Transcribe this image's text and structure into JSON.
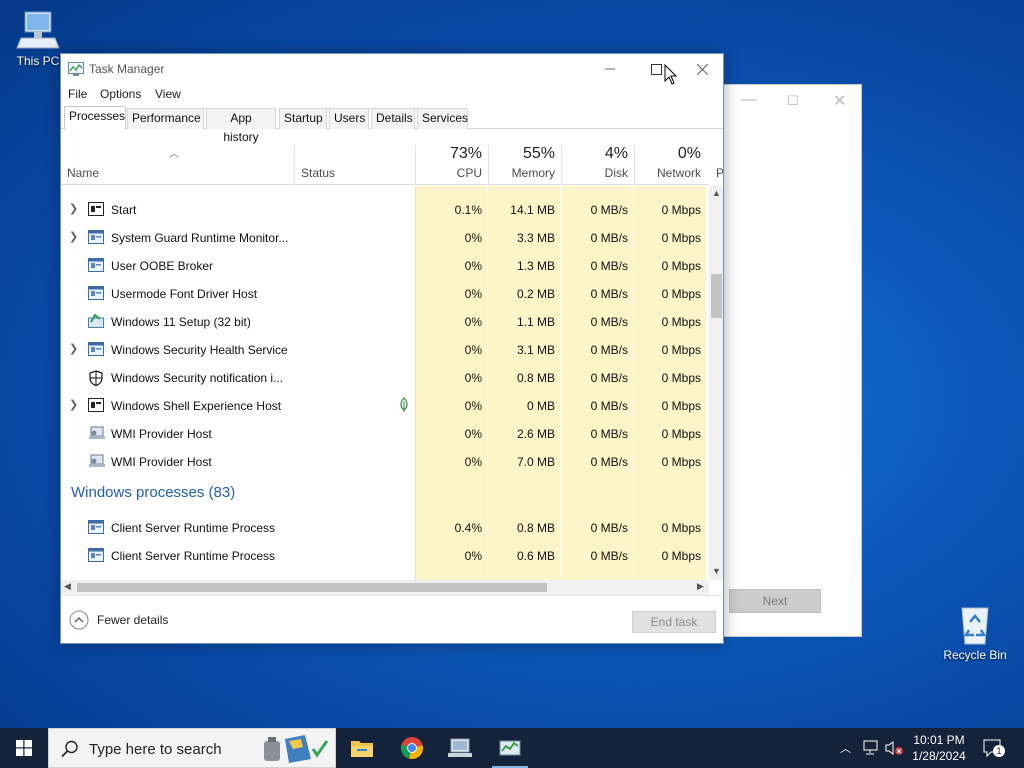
{
  "desktop": {
    "icons": [
      {
        "label": "This PC",
        "icon": "computer-icon"
      },
      {
        "label": "Recycle Bin",
        "icon": "recycle-bin-icon"
      }
    ]
  },
  "setup_window": {
    "next_label": "Next"
  },
  "task_manager": {
    "title": "Task Manager",
    "menu": [
      "File",
      "Options",
      "View"
    ],
    "tabs": [
      "Processes",
      "Performance",
      "App history",
      "Startup",
      "Users",
      "Details",
      "Services"
    ],
    "active_tab": "Processes",
    "columns": {
      "name": "Name",
      "status": "Status",
      "cpu": {
        "percent": "73%",
        "label": "CPU"
      },
      "memory": {
        "percent": "55%",
        "label": "Memory"
      },
      "disk": {
        "percent": "4%",
        "label": "Disk"
      },
      "network": {
        "percent": "0%",
        "label": "Network"
      },
      "power_partial": "P"
    },
    "rows": [
      {
        "name": "Start",
        "expandable": true,
        "icon": "app-window-icon",
        "cpu": "0.1%",
        "memory": "14.1 MB",
        "disk": "0 MB/s",
        "network": "0 Mbps"
      },
      {
        "name": "System Guard Runtime Monitor...",
        "expandable": true,
        "icon": "service-window-icon",
        "cpu": "0%",
        "memory": "3.3 MB",
        "disk": "0 MB/s",
        "network": "0 Mbps"
      },
      {
        "name": "User OOBE Broker",
        "expandable": false,
        "icon": "service-window-icon",
        "cpu": "0%",
        "memory": "1.3 MB",
        "disk": "0 MB/s",
        "network": "0 Mbps"
      },
      {
        "name": "Usermode Font Driver Host",
        "expandable": false,
        "icon": "service-window-icon",
        "cpu": "0%",
        "memory": "0.2 MB",
        "disk": "0 MB/s",
        "network": "0 Mbps"
      },
      {
        "name": "Windows 11 Setup (32 bit)",
        "expandable": false,
        "icon": "setup-icon",
        "cpu": "0%",
        "memory": "1.1 MB",
        "disk": "0 MB/s",
        "network": "0 Mbps"
      },
      {
        "name": "Windows Security Health Service",
        "expandable": true,
        "icon": "service-window-icon",
        "cpu": "0%",
        "memory": "3.1 MB",
        "disk": "0 MB/s",
        "network": "0 Mbps"
      },
      {
        "name": "Windows Security notification i...",
        "expandable": false,
        "icon": "shield-icon",
        "cpu": "0%",
        "memory": "0.8 MB",
        "disk": "0 MB/s",
        "network": "0 Mbps"
      },
      {
        "name": "Windows Shell Experience Host",
        "expandable": true,
        "icon": "app-window-icon",
        "status_icon": "leaf-suspended-icon",
        "cpu": "0%",
        "memory": "0 MB",
        "disk": "0 MB/s",
        "network": "0 Mbps"
      },
      {
        "name": "WMI Provider Host",
        "expandable": false,
        "icon": "wmi-icon",
        "cpu": "0%",
        "memory": "2.6 MB",
        "disk": "0 MB/s",
        "network": "0 Mbps"
      },
      {
        "name": "WMI Provider Host",
        "expandable": false,
        "icon": "wmi-icon",
        "cpu": "0%",
        "memory": "7.0 MB",
        "disk": "0 MB/s",
        "network": "0 Mbps"
      }
    ],
    "section": {
      "title": "Windows processes (83)"
    },
    "section_rows": [
      {
        "name": "Client Server Runtime Process",
        "expandable": false,
        "icon": "service-window-icon",
        "cpu": "0.4%",
        "memory": "0.8 MB",
        "disk": "0 MB/s",
        "network": "0 Mbps"
      },
      {
        "name": "Client Server Runtime Process",
        "expandable": false,
        "icon": "service-window-icon",
        "cpu": "0%",
        "memory": "0.6 MB",
        "disk": "0 MB/s",
        "network": "0 Mbps"
      }
    ],
    "footer": {
      "fewer_details": "Fewer details",
      "end_task": "End task"
    }
  },
  "taskbar": {
    "search_placeholder": "Type here to search",
    "apps": [
      "file-explorer-icon",
      "chrome-icon",
      "network-computer-icon",
      "task-manager-icon"
    ],
    "time": "10:01 PM",
    "date": "1/28/2024",
    "notification_count": "1"
  }
}
